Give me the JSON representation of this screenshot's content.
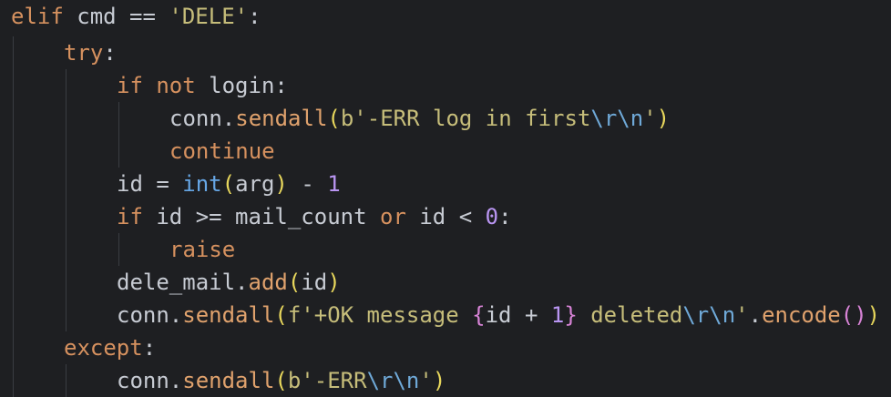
{
  "editor": {
    "language": "python",
    "lines": [
      {
        "tokens": [
          {
            "t": "elif",
            "c": "kw"
          },
          {
            "t": " cmd == "
          },
          {
            "t": "'DELE'",
            "c": "str"
          },
          {
            "t": ":"
          }
        ]
      },
      {
        "tokens": [
          {
            "t": "try",
            "c": "kw"
          },
          {
            "t": ":"
          }
        ]
      },
      {
        "tokens": [
          {
            "t": "if not",
            "c": "kw"
          },
          {
            "t": " login:"
          }
        ]
      },
      {
        "tokens": [
          {
            "t": "conn."
          },
          {
            "t": "sendall",
            "c": "fn"
          },
          {
            "t": "(",
            "c": "paren1"
          },
          {
            "t": "b'-ERR log in first",
            "c": "str"
          },
          {
            "t": "\\r\\n",
            "c": "esc"
          },
          {
            "t": "'",
            "c": "str"
          },
          {
            "t": ")",
            "c": "paren1"
          }
        ]
      },
      {
        "tokens": [
          {
            "t": "continue",
            "c": "kw"
          }
        ]
      },
      {
        "tokens": [
          {
            "t": "id = "
          },
          {
            "t": "int",
            "c": "builtin"
          },
          {
            "t": "(",
            "c": "paren1"
          },
          {
            "t": "arg"
          },
          {
            "t": ")",
            "c": "paren1"
          },
          {
            "t": " - "
          },
          {
            "t": "1",
            "c": "num"
          }
        ]
      },
      {
        "tokens": [
          {
            "t": "if",
            "c": "kw"
          },
          {
            "t": " id >= mail_count "
          },
          {
            "t": "or",
            "c": "kw"
          },
          {
            "t": " id < "
          },
          {
            "t": "0",
            "c": "num"
          },
          {
            "t": ":"
          }
        ]
      },
      {
        "tokens": [
          {
            "t": "raise",
            "c": "kw"
          }
        ]
      },
      {
        "tokens": [
          {
            "t": "dele_mail."
          },
          {
            "t": "add",
            "c": "fn"
          },
          {
            "t": "(",
            "c": "paren1"
          },
          {
            "t": "id"
          },
          {
            "t": ")",
            "c": "paren1"
          }
        ]
      },
      {
        "tokens": [
          {
            "t": "conn."
          },
          {
            "t": "sendall",
            "c": "fn"
          },
          {
            "t": "(",
            "c": "paren1"
          },
          {
            "t": "f'+OK message ",
            "c": "str"
          },
          {
            "t": "{",
            "c": "brace"
          },
          {
            "t": "id + "
          },
          {
            "t": "1",
            "c": "num"
          },
          {
            "t": "}",
            "c": "brace"
          },
          {
            "t": " deleted",
            "c": "str"
          },
          {
            "t": "\\r\\n",
            "c": "esc"
          },
          {
            "t": "'",
            "c": "str"
          },
          {
            "t": "."
          },
          {
            "t": "encode",
            "c": "fn"
          },
          {
            "t": "()",
            "c": "paren2"
          },
          {
            "t": ")",
            "c": "paren1"
          }
        ]
      },
      {
        "tokens": [
          {
            "t": "except",
            "c": "kw"
          },
          {
            "t": ":"
          }
        ]
      },
      {
        "tokens": [
          {
            "t": "conn."
          },
          {
            "t": "sendall",
            "c": "fn"
          },
          {
            "t": "(",
            "c": "paren1"
          },
          {
            "t": "b'-ERR",
            "c": "str"
          },
          {
            "t": "\\r\\n",
            "c": "esc"
          },
          {
            "t": "'",
            "c": "str"
          },
          {
            "t": ")",
            "c": "paren1"
          }
        ]
      }
    ]
  }
}
